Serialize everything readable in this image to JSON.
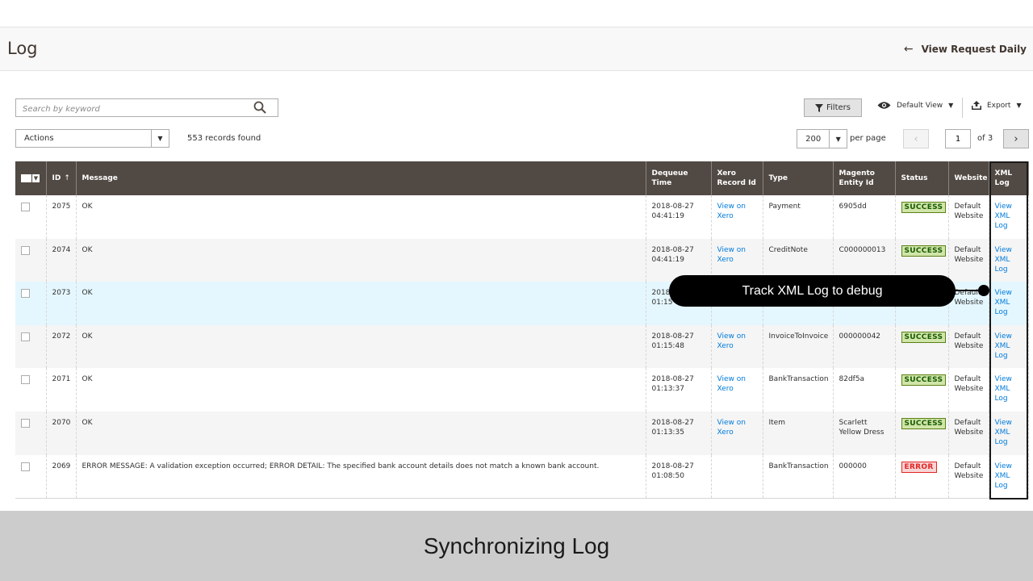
{
  "header": {
    "title": "Log",
    "link_label": "View Request Daily"
  },
  "toolbar": {
    "search_placeholder": "Search by keyword",
    "filters_label": "Filters",
    "view_label": "Default View",
    "export_label": "Export",
    "actions_label": "Actions",
    "records_found": "553 records found",
    "per_page_value": "200",
    "per_page_label": "per page",
    "page_current": "1",
    "page_of": "of 3"
  },
  "grid": {
    "columns": {
      "id": "ID",
      "message": "Message",
      "dequeue": "Dequeue Time",
      "xero_line1": "Xero",
      "xero_line2": "Record Id",
      "type": "Type",
      "magento_line1": "Magento",
      "magento_line2": "Entity Id",
      "status": "Status",
      "website": "Website",
      "xml_line1": "XML",
      "xml_line2": "Log"
    },
    "rows": [
      {
        "id": "2075",
        "message": "OK",
        "date": "2018-08-27",
        "time": "04:41:19",
        "xero_l1": "View on",
        "xero_l2": "Xero",
        "type": "Payment",
        "entity_l1": "6905dd",
        "entity_l2": "",
        "status": "SUCCESS",
        "web_l1": "Default",
        "web_l2": "Website",
        "xml_l1": "View",
        "xml_l2": "XML",
        "xml_l3": "Log"
      },
      {
        "id": "2074",
        "message": "OK",
        "date": "2018-08-27",
        "time": "04:41:19",
        "xero_l1": "View on",
        "xero_l2": "Xero",
        "type": "CreditNote",
        "entity_l1": "C000000013",
        "entity_l2": "",
        "status": "SUCCESS",
        "web_l1": "Default",
        "web_l2": "Website",
        "xml_l1": "View",
        "xml_l2": "XML",
        "xml_l3": "Log"
      },
      {
        "id": "2073",
        "message": "OK",
        "date": "2018",
        "time": "01:15",
        "xero_l1": "",
        "xero_l2": "",
        "type": "",
        "entity_l1": "",
        "entity_l2": "",
        "status": "",
        "web_l1": "Default",
        "web_l2": "Website",
        "xml_l1": "View",
        "xml_l2": "XML",
        "xml_l3": "Log"
      },
      {
        "id": "2072",
        "message": "OK",
        "date": "2018-08-27",
        "time": "01:15:48",
        "xero_l1": "View on",
        "xero_l2": "Xero",
        "type": "InvoiceToInvoice",
        "entity_l1": "000000042",
        "entity_l2": "",
        "status": "SUCCESS",
        "web_l1": "Default",
        "web_l2": "Website",
        "xml_l1": "View",
        "xml_l2": "XML",
        "xml_l3": "Log"
      },
      {
        "id": "2071",
        "message": "OK",
        "date": "2018-08-27",
        "time": "01:13:37",
        "xero_l1": "View on",
        "xero_l2": "Xero",
        "type": "BankTransaction",
        "entity_l1": "82df5a",
        "entity_l2": "",
        "status": "SUCCESS",
        "web_l1": "Default",
        "web_l2": "Website",
        "xml_l1": "View",
        "xml_l2": "XML",
        "xml_l3": "Log"
      },
      {
        "id": "2070",
        "message": "OK",
        "date": "2018-08-27",
        "time": "01:13:35",
        "xero_l1": "View on",
        "xero_l2": "Xero",
        "type": "Item",
        "entity_l1": "Scarlett",
        "entity_l2": "Yellow Dress",
        "status": "SUCCESS",
        "web_l1": "Default",
        "web_l2": "Website",
        "xml_l1": "View",
        "xml_l2": "XML",
        "xml_l3": "Log"
      },
      {
        "id": "2069",
        "message": "ERROR MESSAGE: A validation exception occurred; ERROR DETAIL: The specified bank account details does not match a known bank account.",
        "date": "2018-08-27",
        "time": "01:08:50",
        "xero_l1": "",
        "xero_l2": "",
        "type": "BankTransaction",
        "entity_l1": "000000",
        "entity_l2": "",
        "status": "ERROR",
        "web_l1": "Default",
        "web_l2": "Website",
        "xml_l1": "View",
        "xml_l2": "XML",
        "xml_l3": "Log"
      }
    ]
  },
  "callout": {
    "text": "Track XML Log to debug"
  },
  "footer": {
    "caption": "Synchronizing Log"
  },
  "colors": {
    "header_bg": "#514943",
    "link": "#007bdb",
    "success": "#185b00",
    "error": "#e22626"
  },
  "icons": {
    "back": "arrow-left-icon",
    "search": "search-icon",
    "filter": "funnel-icon",
    "view": "eye-icon",
    "export": "upload-icon"
  }
}
